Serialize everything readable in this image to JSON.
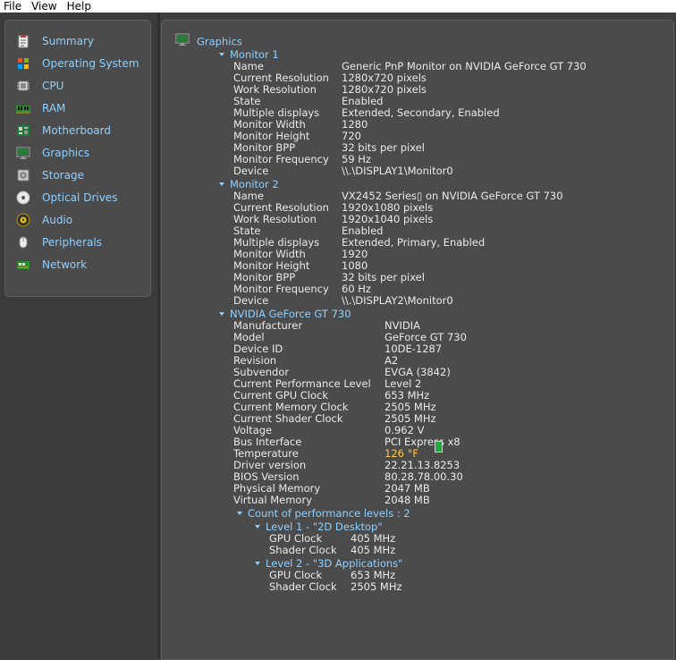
{
  "menu": [
    "File",
    "View",
    "Help"
  ],
  "sidebar": {
    "items": [
      {
        "label": "Summary",
        "icon": "summary-icon"
      },
      {
        "label": "Operating System",
        "icon": "windows-icon"
      },
      {
        "label": "CPU",
        "icon": "cpu-icon"
      },
      {
        "label": "RAM",
        "icon": "ram-icon"
      },
      {
        "label": "Motherboard",
        "icon": "motherboard-icon"
      },
      {
        "label": "Graphics",
        "icon": "monitor-icon"
      },
      {
        "label": "Storage",
        "icon": "storage-icon"
      },
      {
        "label": "Optical Drives",
        "icon": "optical-drive-icon"
      },
      {
        "label": "Audio",
        "icon": "speaker-icon"
      },
      {
        "label": "Peripherals",
        "icon": "mouse-icon"
      },
      {
        "label": "Network",
        "icon": "network-icon"
      }
    ]
  },
  "main": {
    "title": "Graphics",
    "monitor1": {
      "header": "Monitor 1",
      "rows": [
        {
          "k": "Name",
          "v": "Generic PnP Monitor on NVIDIA GeForce GT 730"
        },
        {
          "k": "Current Resolution",
          "v": "1280x720 pixels"
        },
        {
          "k": "Work Resolution",
          "v": "1280x720 pixels"
        },
        {
          "k": "State",
          "v": "Enabled"
        },
        {
          "k": "Multiple displays",
          "v": "Extended, Secondary, Enabled"
        },
        {
          "k": "Monitor Width",
          "v": "1280"
        },
        {
          "k": "Monitor Height",
          "v": "720"
        },
        {
          "k": "Monitor BPP",
          "v": "32 bits per pixel"
        },
        {
          "k": "Monitor Frequency",
          "v": "59 Hz"
        },
        {
          "k": "Device",
          "v": "\\\\.\\DISPLAY1\\Monitor0"
        }
      ]
    },
    "monitor2": {
      "header": "Monitor 2",
      "rows": [
        {
          "k": "Name",
          "v": "VX2452 Series▯ on NVIDIA GeForce GT 730"
        },
        {
          "k": "Current Resolution",
          "v": "1920x1080 pixels"
        },
        {
          "k": "Work Resolution",
          "v": "1920x1040 pixels"
        },
        {
          "k": "State",
          "v": "Enabled"
        },
        {
          "k": "Multiple displays",
          "v": "Extended, Primary, Enabled"
        },
        {
          "k": "Monitor Width",
          "v": "1920"
        },
        {
          "k": "Monitor Height",
          "v": "1080"
        },
        {
          "k": "Monitor BPP",
          "v": "32 bits per pixel"
        },
        {
          "k": "Monitor Frequency",
          "v": "60 Hz"
        },
        {
          "k": "Device",
          "v": "\\\\.\\DISPLAY2\\Monitor0"
        }
      ]
    },
    "gpu": {
      "header": "NVIDIA GeForce GT 730",
      "rows": [
        {
          "k": "Manufacturer",
          "v": "NVIDIA"
        },
        {
          "k": "Model",
          "v": "GeForce GT 730"
        },
        {
          "k": "Device ID",
          "v": "10DE-1287"
        },
        {
          "k": "Revision",
          "v": "A2"
        },
        {
          "k": "Subvendor",
          "v": "EVGA (3842)"
        },
        {
          "k": "Current Performance Level",
          "v": "Level 2"
        },
        {
          "k": "Current GPU Clock",
          "v": "653 MHz"
        },
        {
          "k": "Current Memory Clock",
          "v": "2505 MHz"
        },
        {
          "k": "Current Shader Clock",
          "v": "2505 MHz"
        },
        {
          "k": "Voltage",
          "v": "0.962 V"
        },
        {
          "k": "Bus Interface",
          "v": "PCI Express x8"
        },
        {
          "k": "Temperature",
          "v": "126 °F"
        },
        {
          "k": "Driver version",
          "v": "22.21.13.8253"
        },
        {
          "k": "BIOS Version",
          "v": "80.28.78.00.30"
        },
        {
          "k": "Physical Memory",
          "v": "2047 MB"
        },
        {
          "k": "Virtual Memory",
          "v": "2048 MB"
        }
      ],
      "perf_header": "Count of performance levels : 2",
      "levels": [
        {
          "header": "Level 1 - \"2D Desktop\"",
          "rows": [
            {
              "k": "GPU Clock",
              "v": "405 MHz"
            },
            {
              "k": "Shader Clock",
              "v": "405 MHz"
            }
          ]
        },
        {
          "header": "Level 2 - \"3D Applications\"",
          "rows": [
            {
              "k": "GPU Clock",
              "v": "653 MHz"
            },
            {
              "k": "Shader Clock",
              "v": "2505 MHz"
            }
          ]
        }
      ]
    }
  },
  "colors": {
    "accent": "#8fd0ff",
    "panel": "#4b4b4b",
    "background": "#3f3f3f",
    "temperature": "#ffcc33",
    "thermometer": "#1faa3a"
  }
}
